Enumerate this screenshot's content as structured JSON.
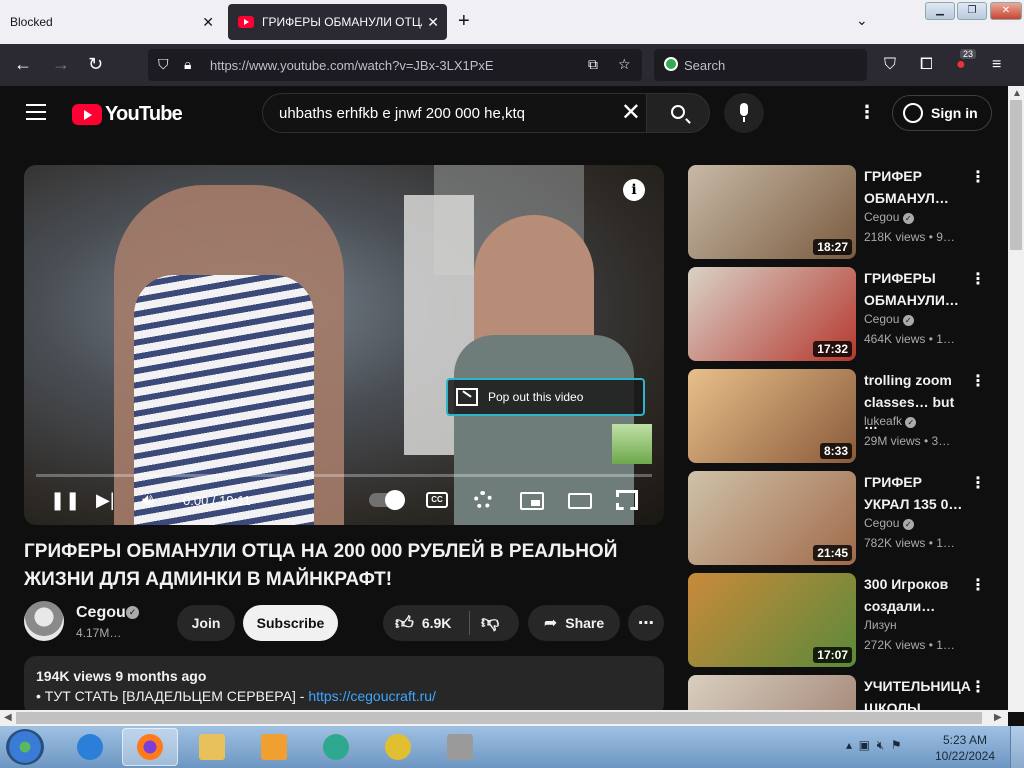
{
  "browser": {
    "tabs": [
      {
        "title": "Blocked"
      },
      {
        "title": "ГРИФЕРЫ ОБМАНУЛИ ОТЦА Н"
      }
    ],
    "url": "https://www.youtube.com/watch?v=JBx-3LX1PxE",
    "search_placeholder": "Search",
    "badge_count": "23"
  },
  "youtube": {
    "logo_text": "YouTube",
    "search_query": "uhbaths erhfkb e jnwf 200 000 he,ktq",
    "sign_in": "Sign in",
    "player": {
      "time": "0:00 / 19:11",
      "popout_label": "Pop out this video",
      "cc_label": "CC",
      "progress": 0.0
    },
    "video": {
      "title": "ГРИФЕРЫ ОБМАНУЛИ ОТЦА НА 200 000 РУБЛЕЙ В РЕАЛЬНОЙ ЖИЗНИ ДЛЯ АДМИНКИ В МАЙНКРАФТ!",
      "channel": "Cegou",
      "subscribers": "4.17M…",
      "join": "Join",
      "subscribe": "Subscribe",
      "likes": "6.9K",
      "share": "Share",
      "views_age": "194K views  9 months ago",
      "desc_prefix": "• ТУТ СТАТЬ [ВЛАДЕЛЬЦЕМ СЕРВЕРА] - ",
      "desc_link": "https://cegoucraft.ru/"
    },
    "recommendations": [
      {
        "title": "ГРИФЕР ОБМАНУЛ…",
        "channel": "Cegou",
        "meta": "218K views  • 9…",
        "duration": "18:27",
        "verified": true,
        "colors": [
          "#c7b9a6",
          "#7a5b3f"
        ]
      },
      {
        "title": "ГРИФЕРЫ ОБМАНУЛИ…",
        "channel": "Cegou",
        "meta": "464K views  • 1…",
        "duration": "17:32",
        "verified": true,
        "colors": [
          "#d9d2c7",
          "#b5382e"
        ]
      },
      {
        "title": "trolling zoom classes… but …",
        "channel": "lukeafk",
        "meta": "29M views  • 3…",
        "duration": "8:33",
        "verified": true,
        "colors": [
          "#e8c08a",
          "#8a5a3a"
        ]
      },
      {
        "title": "ГРИФЕР УКРАЛ 135 0…",
        "channel": "Cegou",
        "meta": "782K views  • 1…",
        "duration": "21:45",
        "verified": true,
        "colors": [
          "#cfc2a8",
          "#a06a4a"
        ]
      },
      {
        "title": "300 Игроков создали…",
        "channel": "Лизун",
        "meta": "272K views  • 1…",
        "duration": "17:07",
        "verified": false,
        "colors": [
          "#c98a3a",
          "#5a8a3a"
        ]
      },
      {
        "title": "УЧИТЕЛЬНИЦА ШКОЛЫ…",
        "channel": "",
        "meta": "",
        "duration": "",
        "verified": false,
        "colors": [
          "#d8cfc0",
          "#9a7a6a"
        ]
      }
    ]
  },
  "taskbar": {
    "time": "5:23 AM",
    "date": "10/22/2024"
  }
}
